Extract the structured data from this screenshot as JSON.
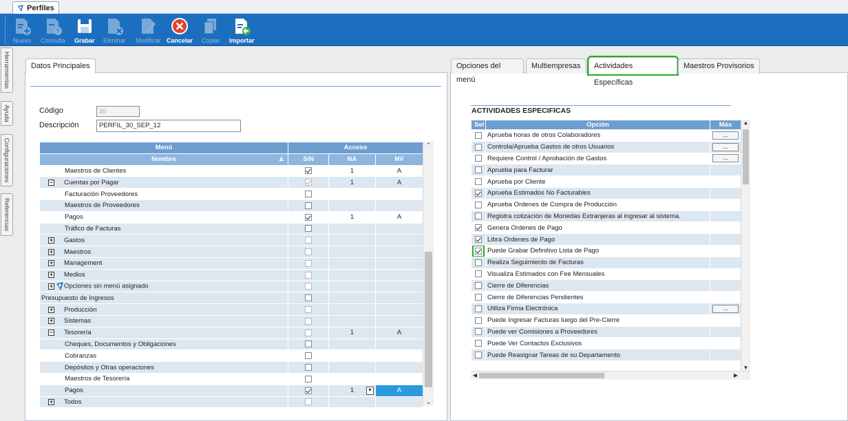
{
  "app_tab": "Perfiles",
  "toolbar": [
    {
      "name": "nuevo-button",
      "label": "Nuevo",
      "enabled": false,
      "icon": "doc-plus"
    },
    {
      "name": "consulta-button",
      "label": "Consulta",
      "enabled": false,
      "icon": "doc-query"
    },
    {
      "name": "grabar-button",
      "label": "Grabar",
      "enabled": true,
      "icon": "save"
    },
    {
      "name": "eliminar-button",
      "label": "Eliminar",
      "enabled": false,
      "icon": "doc-delete"
    },
    {
      "name": "modificar-button",
      "label": "Modificar",
      "enabled": false,
      "icon": "edit"
    },
    {
      "name": "cancelar-button",
      "label": "Cancelar",
      "enabled": true,
      "icon": "cancel"
    },
    {
      "name": "copiar-button",
      "label": "Copiar",
      "enabled": false,
      "icon": "copy"
    },
    {
      "name": "importar-button",
      "label": "Importar",
      "enabled": true,
      "icon": "import"
    }
  ],
  "side_tabs": [
    "Herramientas",
    "Ayuda",
    "Configuraciones",
    "Referencias"
  ],
  "left": {
    "tab": "Datos Principales",
    "codigo_label": "Código",
    "codigo_value": "30",
    "descripcion_label": "Descripción",
    "descripcion_value": "PERFIL_30_SEP_12",
    "header_menu": "Menú",
    "header_acceso": "Acceso",
    "col_nombre": "Nombre",
    "col_sn": "S/N",
    "col_na": "NA",
    "col_nv": "NV",
    "rows": [
      {
        "exp": "",
        "indent": 2,
        "name": "Maestros de Clientes",
        "sn": "chk",
        "na": "1",
        "nv": "A"
      },
      {
        "exp": "-",
        "indent": 1,
        "name": "Cuentas por Pagar",
        "sn": "chkdis",
        "na": "1",
        "nv": "A"
      },
      {
        "exp": "",
        "indent": 2,
        "name": "Facturación Proveedores",
        "sn": "empty",
        "na": "",
        "nv": ""
      },
      {
        "exp": "",
        "indent": 2,
        "name": "Maestros de Proveedores",
        "sn": "empty",
        "na": "",
        "nv": ""
      },
      {
        "exp": "",
        "indent": 2,
        "name": "Pagos",
        "sn": "chk",
        "na": "1",
        "nv": "A"
      },
      {
        "exp": "",
        "indent": 2,
        "name": "Tráfico de Facturas",
        "sn": "empty",
        "na": "",
        "nv": ""
      },
      {
        "exp": "+",
        "indent": 1,
        "name": "Gastos",
        "sn": "dis",
        "na": "",
        "nv": ""
      },
      {
        "exp": "+",
        "indent": 1,
        "name": "Maestros",
        "sn": "dis",
        "na": "",
        "nv": ""
      },
      {
        "exp": "+",
        "indent": 1,
        "name": "Management",
        "sn": "dis",
        "na": "",
        "nv": ""
      },
      {
        "exp": "+",
        "indent": 1,
        "name": "Medios",
        "sn": "dis",
        "na": "",
        "nv": ""
      },
      {
        "exp": "+",
        "indent": 1,
        "name": "Opciones sin menú asignado",
        "sn": "dis",
        "na": "",
        "nv": "",
        "logo": true
      },
      {
        "exp": "",
        "indent": 0,
        "name": "Presupuesto de Ingresos",
        "sn": "empty",
        "na": "",
        "nv": ""
      },
      {
        "exp": "+",
        "indent": 1,
        "name": "Producción",
        "sn": "dis",
        "na": "",
        "nv": ""
      },
      {
        "exp": "+",
        "indent": 1,
        "name": "Sistemas",
        "sn": "dis",
        "na": "",
        "nv": ""
      },
      {
        "exp": "-",
        "indent": 1,
        "name": "Tesorería",
        "sn": "dis",
        "na": "1",
        "nv": "A"
      },
      {
        "exp": "",
        "indent": 2,
        "name": "Cheques, Documentos y Obligaciones",
        "sn": "empty",
        "na": "",
        "nv": ""
      },
      {
        "exp": "",
        "indent": 2,
        "name": "Cobranzas",
        "sn": "empty",
        "na": "",
        "nv": ""
      },
      {
        "exp": "",
        "indent": 2,
        "name": "Depósitos y Otras operaciones",
        "sn": "empty",
        "na": "",
        "nv": ""
      },
      {
        "exp": "",
        "indent": 2,
        "name": "Maestros de Tesorería",
        "sn": "empty",
        "na": "",
        "nv": ""
      },
      {
        "exp": "",
        "indent": 2,
        "name": "Pagos",
        "sn": "chk",
        "na": "1",
        "nv": "A",
        "editing": true
      },
      {
        "exp": "+",
        "indent": 1,
        "name": "Todos",
        "sn": "dis",
        "na": "",
        "nv": ""
      }
    ]
  },
  "right": {
    "tabs": [
      "Opciones del menú",
      "Multiempresas",
      "Actividades Específicas",
      "Maestros Provisorios"
    ],
    "active_tab": 2,
    "section_title": "ACTIVIDADES ESPECIFICAS",
    "col_sel": "Sel",
    "col_opcion": "Opción",
    "col_mas": "Más",
    "more_label": "...",
    "rows": [
      {
        "sel": false,
        "text": "Aprueba horas de otros Colaboradores",
        "more": true
      },
      {
        "sel": false,
        "text": "Controla/Aprueba Gastos de otros Usuarios",
        "more": true
      },
      {
        "sel": false,
        "text": "Requiere Control / Aprobación de Gastos",
        "more": true
      },
      {
        "sel": false,
        "text": "Aprueba para Facturar",
        "more": false
      },
      {
        "sel": false,
        "text": "Aprueba por Cliente",
        "more": false
      },
      {
        "sel": true,
        "text": "Aprueba Estimados No Facturables",
        "more": false
      },
      {
        "sel": false,
        "text": "Aprueba Ordenes de Compra de Producción",
        "more": false
      },
      {
        "sel": false,
        "text": "Registra cotización de Monedas Extranjeras al ingresar al sistema.",
        "more": false
      },
      {
        "sel": true,
        "text": "Genera Ordenes de Pago",
        "more": false
      },
      {
        "sel": true,
        "text": "Libra Ordenes de Pago",
        "more": false
      },
      {
        "sel": true,
        "text": "Puede Grabar Definitivo Lista de Pago",
        "more": false,
        "highlight": true
      },
      {
        "sel": false,
        "text": "Realiza Seguimiento de Facturas",
        "more": false
      },
      {
        "sel": false,
        "text": "Visualiza Estimados con Fee Mensuales",
        "more": false
      },
      {
        "sel": false,
        "text": "Cierre de Diferencias",
        "more": false
      },
      {
        "sel": false,
        "text": "Cierre de Diferencias Pendientes",
        "more": false
      },
      {
        "sel": false,
        "text": "Utiliza Firma Electrónica",
        "more": true
      },
      {
        "sel": false,
        "text": "Puede Ingresar Facturas luego del Pre-Cierre",
        "more": false
      },
      {
        "sel": false,
        "text": "Puede ver Comisiones a Proveedores",
        "more": false
      },
      {
        "sel": false,
        "text": "Puede Ver Contactos Exclusivos",
        "more": false
      },
      {
        "sel": false,
        "text": "Puede Reasignar Tareas de su Departamento",
        "more": false
      }
    ]
  },
  "colors": {
    "toolbar": "#1c6fbf",
    "grid_header": "#6d9ed0",
    "row_alt": "#dde7f0",
    "highlight": "#19b319",
    "selected_cell": "#2b9be0"
  }
}
